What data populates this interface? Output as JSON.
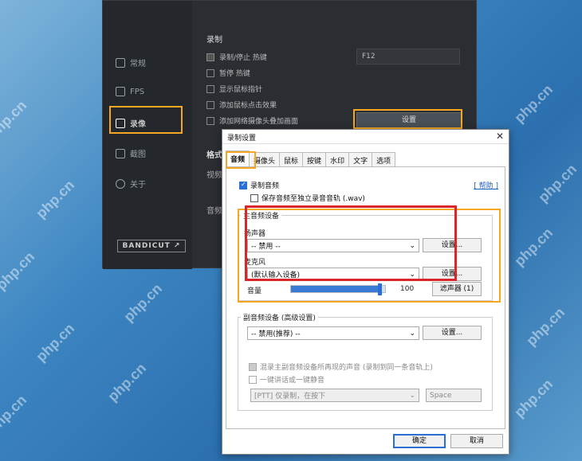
{
  "watermark": "php.cn",
  "app": {
    "nav": [
      {
        "label": "常规"
      },
      {
        "label": "FPS"
      },
      {
        "label": "录像"
      },
      {
        "label": "截图"
      },
      {
        "label": "关于"
      }
    ],
    "logo_text": "BANDICUT ↗",
    "section_record": "录制",
    "options": [
      {
        "label": "录制/停止 热键",
        "checked": true
      },
      {
        "label": "暂停 热键",
        "checked": false
      },
      {
        "label": "显示鼠标指针",
        "checked": false
      },
      {
        "label": "添加鼠标点击效果",
        "checked": false
      },
      {
        "label": "添加网络摄像头叠加画面",
        "checked": false
      }
    ],
    "hotkey_value": "F12",
    "settings_button": "设置",
    "format_label": "格式",
    "video_label": "视频",
    "audio_label": "音频"
  },
  "dialog": {
    "title": "录制设置",
    "tabs": [
      "音频",
      "摄像头",
      "鼠标",
      "按键",
      "水印",
      "文字",
      "选项"
    ],
    "help_link": "[ 帮助 ]",
    "record_audio": "录制音频",
    "save_separate": "保存音频至独立录音音轨 (.wav)",
    "main_group": "主音频设备",
    "speaker_label": "扬声器",
    "speaker_value": "-- 禁用 --",
    "mic_label": "麦克风",
    "mic_value": "(默认输入设备)",
    "setup_btn": "设置...",
    "volume_label": "音量",
    "volume_value": "100",
    "filter_btn": "滤声器 (1)",
    "secondary_group": "副音频设备 (高级设置)",
    "secondary_value": "-- 禁用(推荐) --",
    "mix_label": "混录主副音频设备所再现的声音 (录制到同一条音轨上)",
    "ptt_label": "一键讲话或一键静音",
    "ptt_value": "[PTT] 仅录制，在按下",
    "ptt_key": "Space",
    "ok": "确定",
    "cancel": "取消",
    "volume_level": 0.95
  }
}
